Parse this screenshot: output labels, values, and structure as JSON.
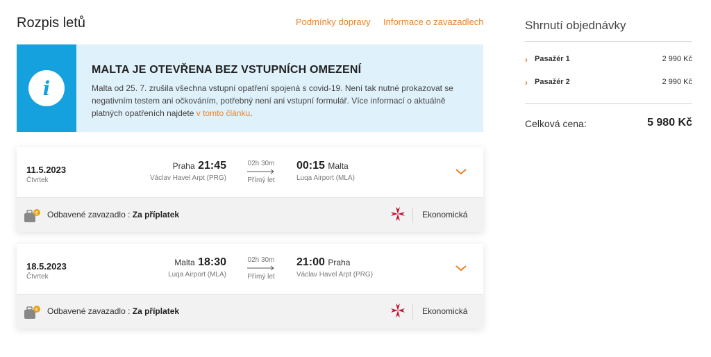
{
  "header": {
    "title": "Rozpis letů",
    "links": [
      "Podmínky dopravy",
      "Informace o zavazadlech"
    ]
  },
  "banner": {
    "heading": "MALTA JE OTEVŘENA BEZ VSTUPNÍCH OMEZENÍ",
    "body": "Malta od 25. 7. zrušila všechna vstupní opatření spojená s covid-19. Není tak nutné prokazovat se negativním testem ani očkováním, potřebný není ani vstupní formulář. Více informací o aktuálně platných opatřeních najdete ",
    "link": "v tomto článku",
    "end": ".",
    "icon": "info-icon"
  },
  "flights": [
    {
      "date": "11.5.2023",
      "day": "Čtvrtek",
      "dep_city": "Praha",
      "dep_time": "21:45",
      "dep_airport": "Václav Havel Arpt (PRG)",
      "duration": "02h 30m",
      "stops": "Přímý let",
      "arr_time": "00:15",
      "arr_city": "Malta",
      "arr_airport": "Luqa Airport (MLA)",
      "baggage_label": "Odbavené zavazadlo : ",
      "baggage_value": "Za příplatek",
      "cabin": "Ekonomická"
    },
    {
      "date": "18.5.2023",
      "day": "Čtvrtek",
      "dep_city": "Malta",
      "dep_time": "18:30",
      "dep_airport": "Luqa Airport (MLA)",
      "duration": "02h 30m",
      "stops": "Přímý let",
      "arr_time": "21:00",
      "arr_city": "Praha",
      "arr_airport": "Václav Havel Arpt (PRG)",
      "baggage_label": "Odbavené zavazadlo : ",
      "baggage_value": "Za příplatek",
      "cabin": "Ekonomická"
    }
  ],
  "summary": {
    "title": "Shrnutí objednávky",
    "passengers": [
      {
        "label": "Pasažér 1",
        "price": "2 990 Kč"
      },
      {
        "label": "Pasažér 2",
        "price": "2 990 Kč"
      }
    ],
    "total_label": "Celková cena:",
    "total_price": "5 980 Kč"
  },
  "colors": {
    "accent": "#e8832a",
    "info_blue": "#14a1dd",
    "banner_bg": "#dff1fa",
    "airline_red": "#c8102e"
  }
}
